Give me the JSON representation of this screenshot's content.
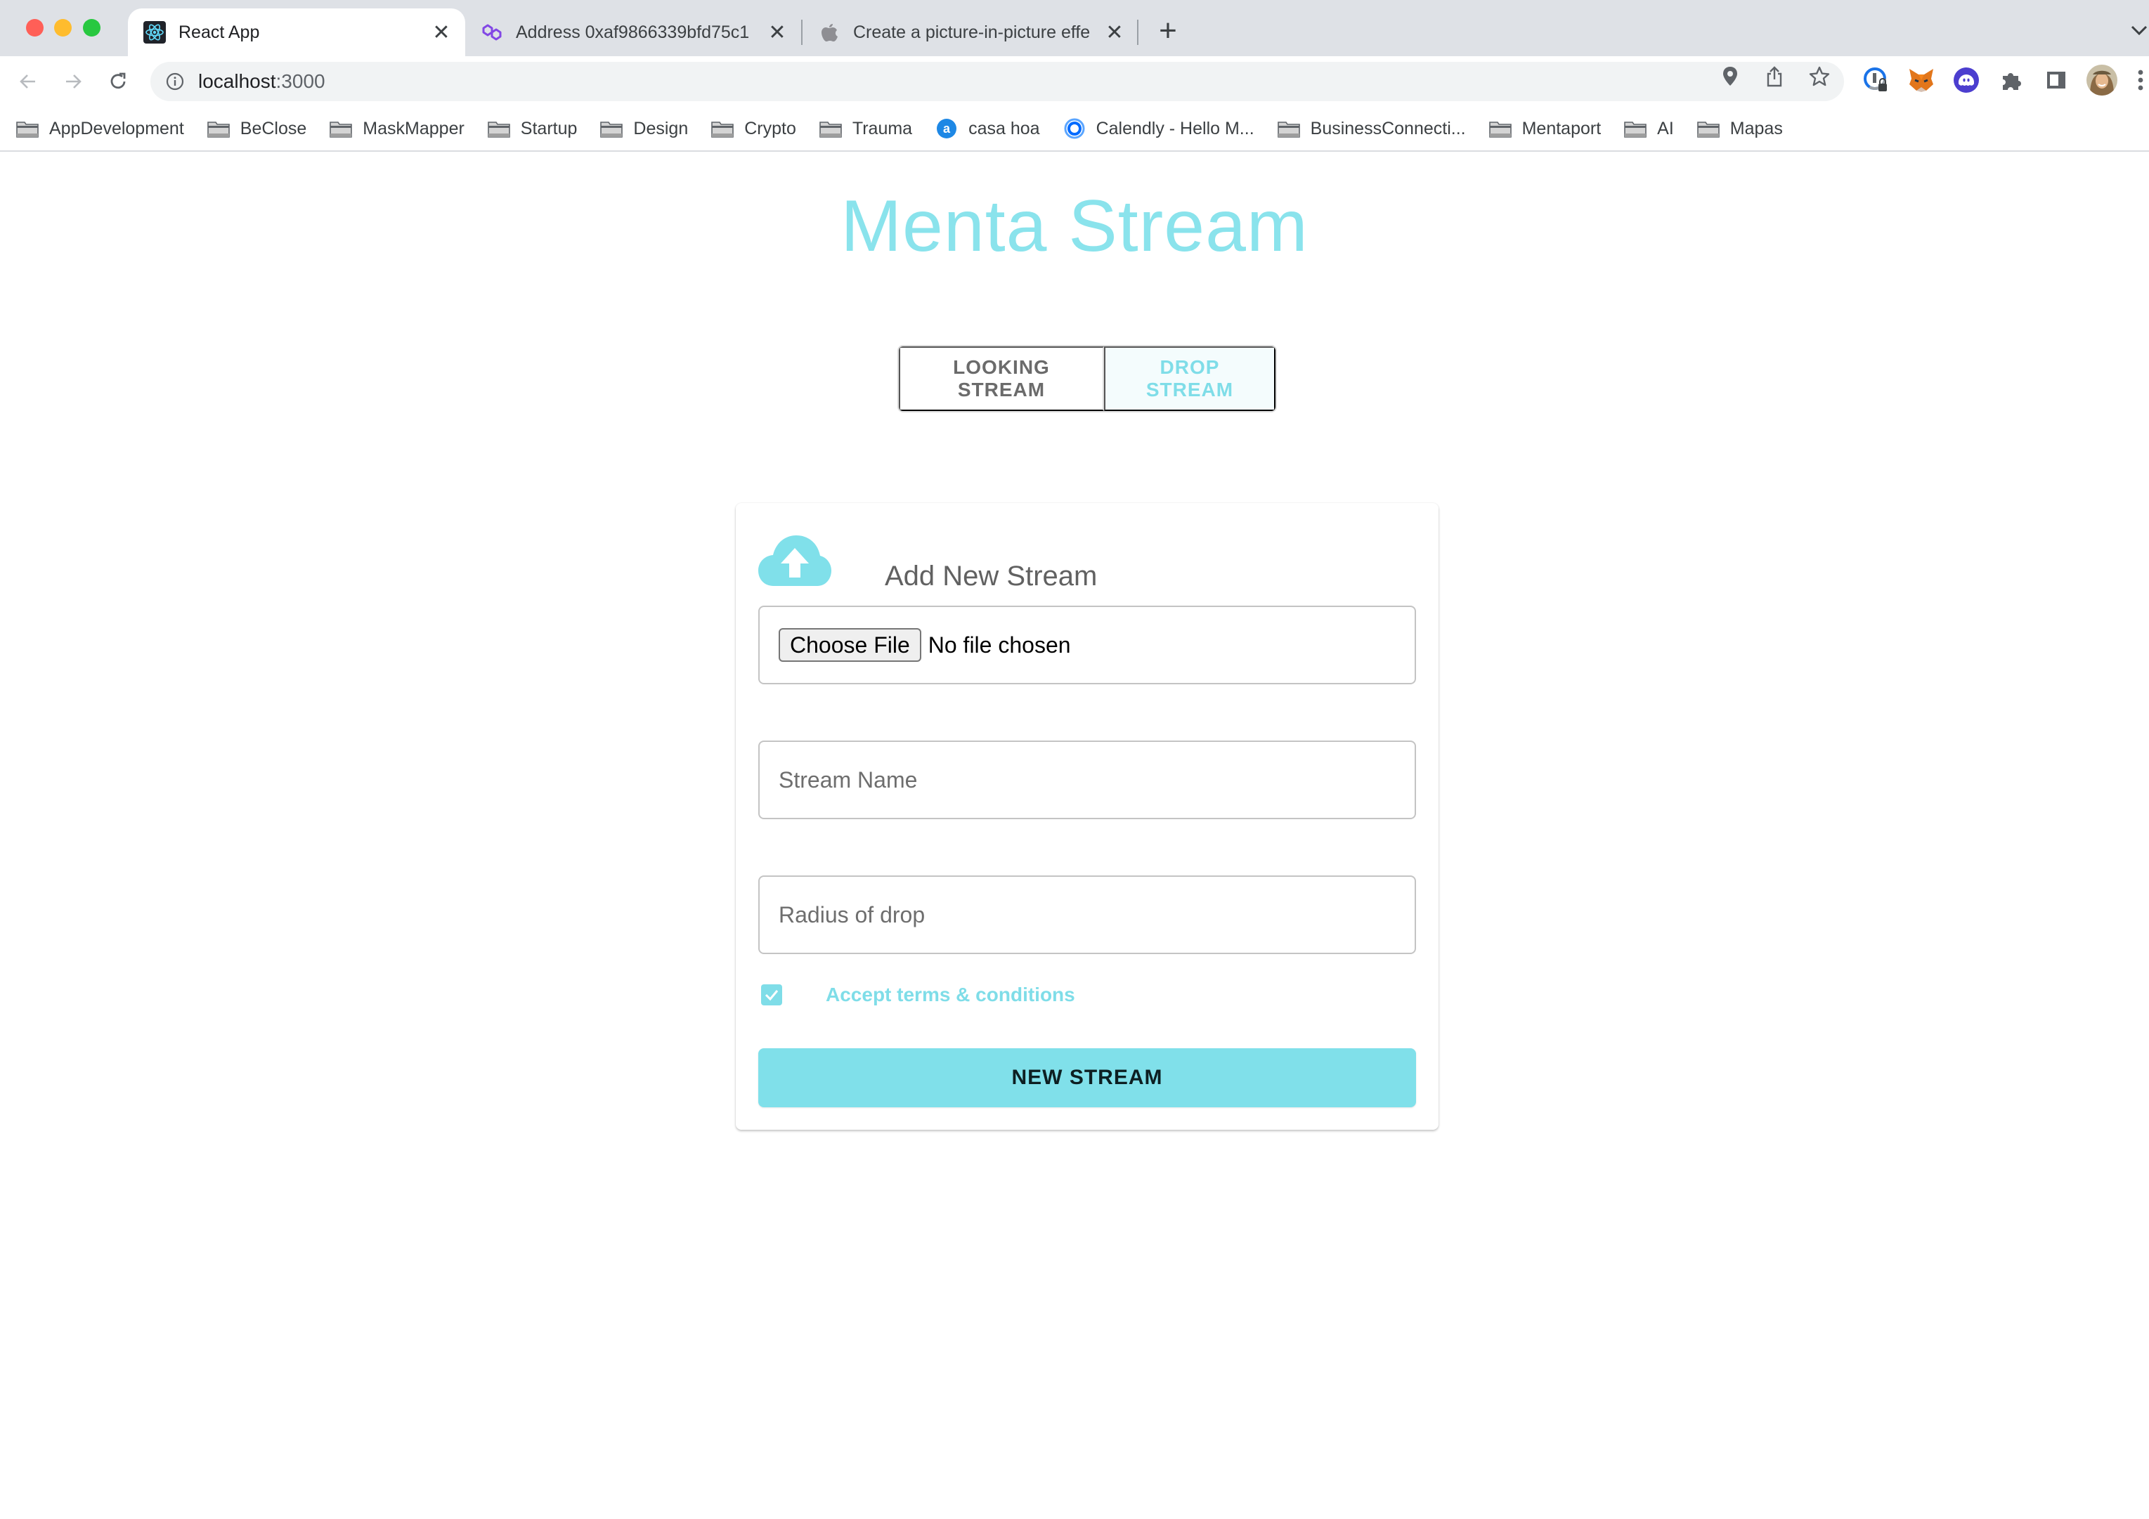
{
  "browser": {
    "tabs": [
      {
        "title": "React App",
        "icon": "react-icon",
        "active": true
      },
      {
        "title": "Address 0xaf9866339bfd75c1",
        "icon": "polygon-icon",
        "active": false
      },
      {
        "title": "Create a picture-in-picture effe",
        "icon": "apple-icon",
        "active": false
      }
    ],
    "new_tab_label": "+",
    "close_label": "✕",
    "address": {
      "host": "localhost",
      "port": ":3000"
    },
    "bookmarks": [
      {
        "label": "AppDevelopment",
        "icon": "folder-icon"
      },
      {
        "label": "BeClose",
        "icon": "folder-icon"
      },
      {
        "label": "MaskMapper",
        "icon": "folder-icon"
      },
      {
        "label": "Startup",
        "icon": "folder-icon"
      },
      {
        "label": "Design",
        "icon": "folder-icon"
      },
      {
        "label": "Crypto",
        "icon": "folder-icon"
      },
      {
        "label": "Trauma",
        "icon": "folder-icon"
      },
      {
        "label": "casa hoa",
        "icon": "site-a-icon"
      },
      {
        "label": "Calendly - Hello M...",
        "icon": "calendly-icon"
      },
      {
        "label": "BusinessConnecti...",
        "icon": "folder-icon"
      },
      {
        "label": "Mentaport",
        "icon": "folder-icon"
      },
      {
        "label": "AI",
        "icon": "folder-icon"
      },
      {
        "label": "Mapas",
        "icon": "folder-icon"
      }
    ],
    "extensions": [
      "password-manager-icon",
      "metamask-fox-icon",
      "phantom-ghost-icon",
      "puzzle-extensions-icon",
      "side-panel-icon",
      "profile-avatar"
    ]
  },
  "app": {
    "title": "Menta Stream",
    "colors": {
      "accent": "#80e0ea",
      "title": "#8ae3ec",
      "muted_text": "#6b6b6b"
    },
    "mode_toggle": {
      "options": [
        {
          "label": "LOOKING STREAM",
          "selected": false
        },
        {
          "label": "DROP STREAM",
          "selected": true
        }
      ]
    },
    "form": {
      "title": "Add New Stream",
      "file_input": {
        "button_label": "Choose File",
        "status": "No file chosen"
      },
      "stream_name": {
        "placeholder": "Stream Name",
        "value": ""
      },
      "radius": {
        "placeholder": "Radius of drop",
        "value": ""
      },
      "terms": {
        "label": "Accept terms & conditions",
        "checked": true
      },
      "submit_label": "NEW STREAM"
    }
  }
}
